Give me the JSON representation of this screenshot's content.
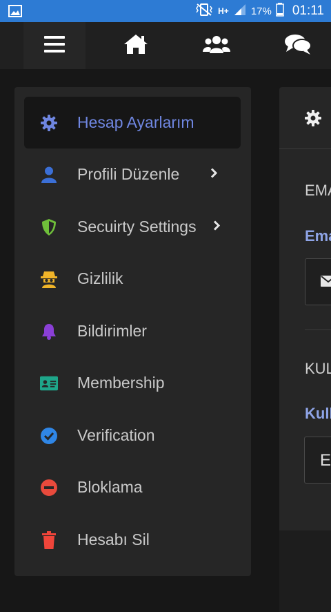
{
  "status_bar": {
    "battery": "17%",
    "time": "01:11",
    "network": "H+"
  },
  "nav": {
    "items": [
      {
        "name": "menu-icon"
      },
      {
        "name": "home-icon"
      },
      {
        "name": "users-icon"
      },
      {
        "name": "chat-icon"
      }
    ]
  },
  "sidebar": {
    "items": [
      {
        "label": "Hesap Ayarlarım",
        "icon": "gear-icon",
        "color": "#6f86e0"
      },
      {
        "label": "Profili Düzenle",
        "icon": "user-icon",
        "color": "#3b6fd6"
      },
      {
        "label": "Secuirty Settings",
        "icon": "shield-icon",
        "color": "#6fbf3a"
      },
      {
        "label": "Gizlilik",
        "icon": "spy-icon",
        "color": "#f0b429"
      },
      {
        "label": "Bildirimler",
        "icon": "bell-icon",
        "color": "#8a3fd6"
      },
      {
        "label": "Membership",
        "icon": "id-card-icon",
        "color": "#1ea68a"
      },
      {
        "label": "Verification",
        "icon": "check-circle-icon",
        "color": "#2f86e6"
      },
      {
        "label": "Bloklama",
        "icon": "block-icon",
        "color": "#e84a3c"
      },
      {
        "label": "Hesabı Sil",
        "icon": "trash-icon",
        "color": "#f0453a"
      }
    ]
  },
  "panel": {
    "email_heading": "EMA",
    "email_label": "Ema",
    "username_heading": "KUL",
    "username_label": "Kull",
    "username_value": "E"
  },
  "colors": {
    "status_bar": "#2d7bd4",
    "accent": "#6f86e0",
    "background": "#171717",
    "card": "#262626"
  }
}
